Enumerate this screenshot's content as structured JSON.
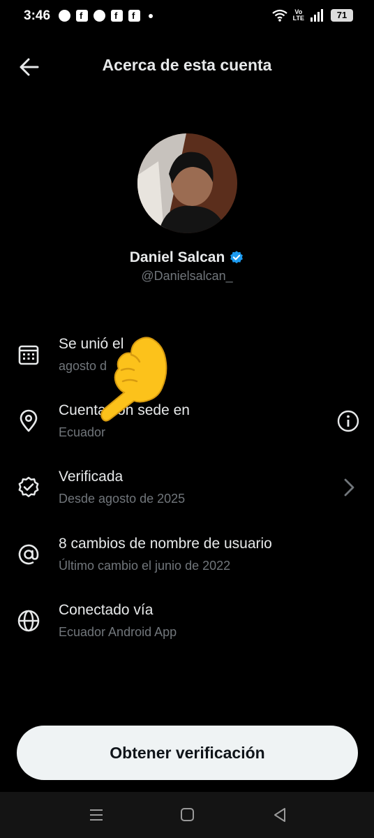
{
  "status_bar": {
    "time": "3:46",
    "volte_top": "Vo",
    "volte_bottom": "LTE",
    "battery": "71"
  },
  "header": {
    "title": "Acerca de esta cuenta"
  },
  "profile": {
    "name": "Daniel Salcan",
    "handle": "@Danielsalcan_"
  },
  "rows": [
    {
      "icon": "calendar-icon",
      "title": "Se unió el",
      "subtitle": "agosto d"
    },
    {
      "icon": "location-pin-icon",
      "title": "Cuenta con sede en",
      "subtitle": "Ecuador"
    },
    {
      "icon": "verified-badge-icon",
      "title": "Verificada",
      "subtitle": "Desde agosto de 2025"
    },
    {
      "icon": "at-sign-icon",
      "title": "8 cambios de nombre de usuario",
      "subtitle": "Último cambio el junio de 2022"
    },
    {
      "icon": "globe-icon",
      "title": "Conectado vía",
      "subtitle": "Ecuador Android App"
    }
  ],
  "cta": {
    "label": "Obtener verificación"
  },
  "colors": {
    "background": "#000000",
    "primary_text": "#e7e9ea",
    "secondary_text": "#71767b",
    "verified_blue": "#1d9bf0",
    "button_bg": "#eff3f4"
  }
}
